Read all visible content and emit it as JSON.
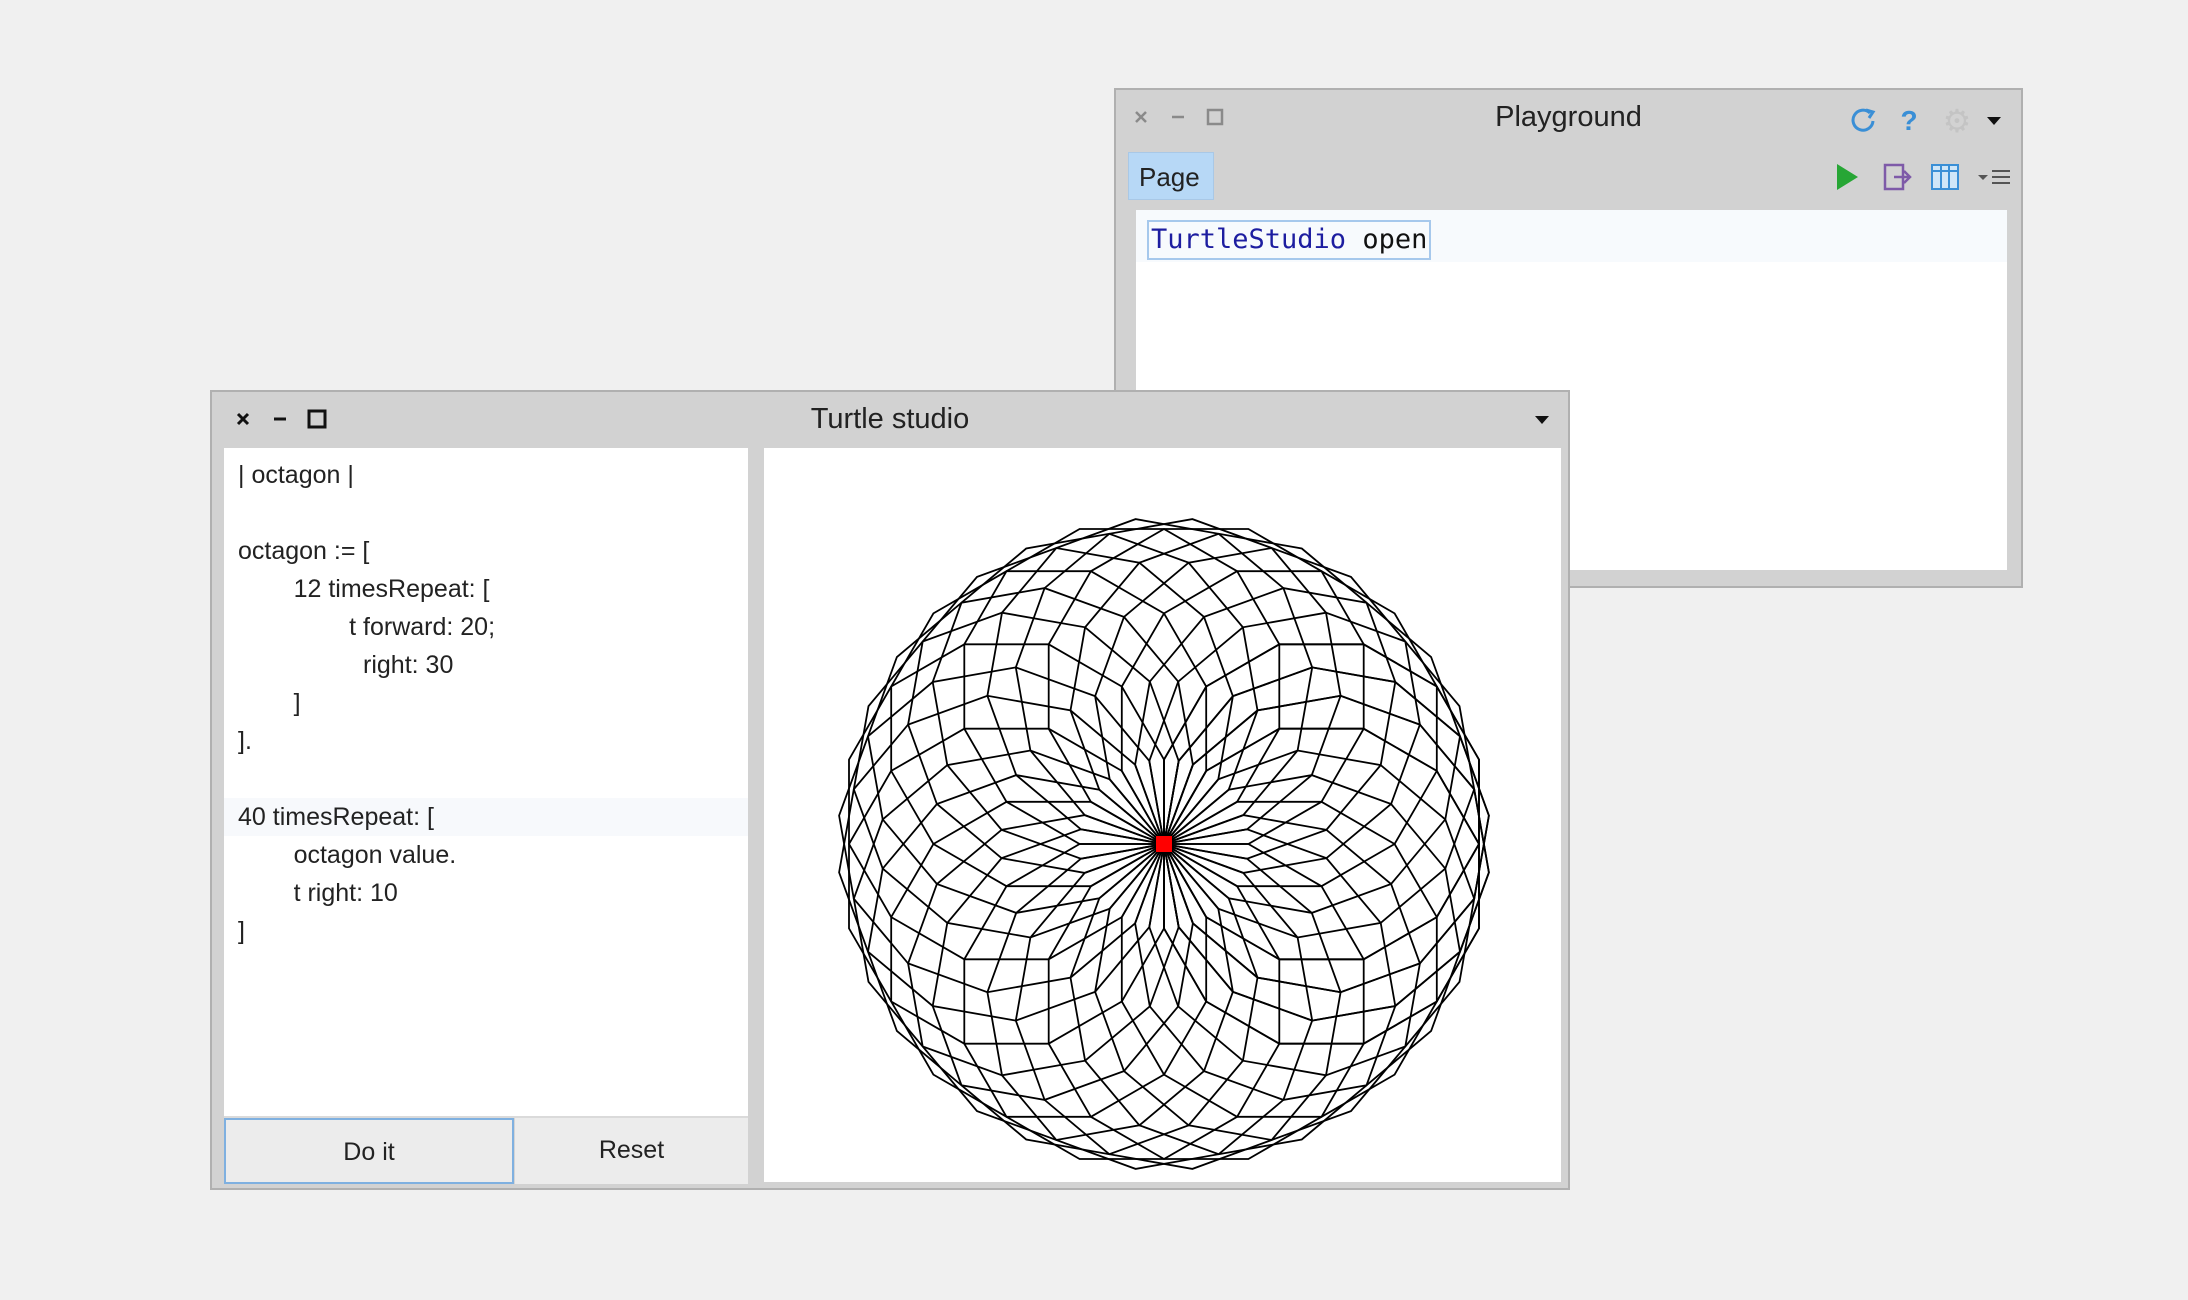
{
  "playground": {
    "title": "Playground",
    "tab_label": "Page",
    "code_class": "TurtleStudio",
    "code_message": " open",
    "icons": [
      "sync-icon",
      "help-icon",
      "settings-icon",
      "dropdown-icon",
      "run-icon",
      "export-icon",
      "bindings-icon",
      "menu-icon"
    ]
  },
  "turtle": {
    "title": "Turtle studio",
    "code_lines": [
      "| octagon |",
      "",
      "octagon := [",
      "        12 timesRepeat: [",
      "                t forward: 20;",
      "                  right: 30",
      "        ]",
      "].",
      "",
      "40 timesRepeat: [",
      "        octagon value.",
      "        t right: 10",
      "]"
    ],
    "do_it_label": "Do it",
    "reset_label": "Reset",
    "drawing": {
      "repeats": 40,
      "sides": 12,
      "side_length": 20,
      "turn_angle": 30,
      "rotate_between": 10,
      "pen_color": "#000000",
      "turtle_color": "#ff0000"
    }
  },
  "colors": {
    "desktop": "#f0f0f0",
    "tab_selected": "#b7d8f6",
    "run_green": "#27a635",
    "sync_blue": "#3a8fd6",
    "code_class": "#1d1da0"
  }
}
